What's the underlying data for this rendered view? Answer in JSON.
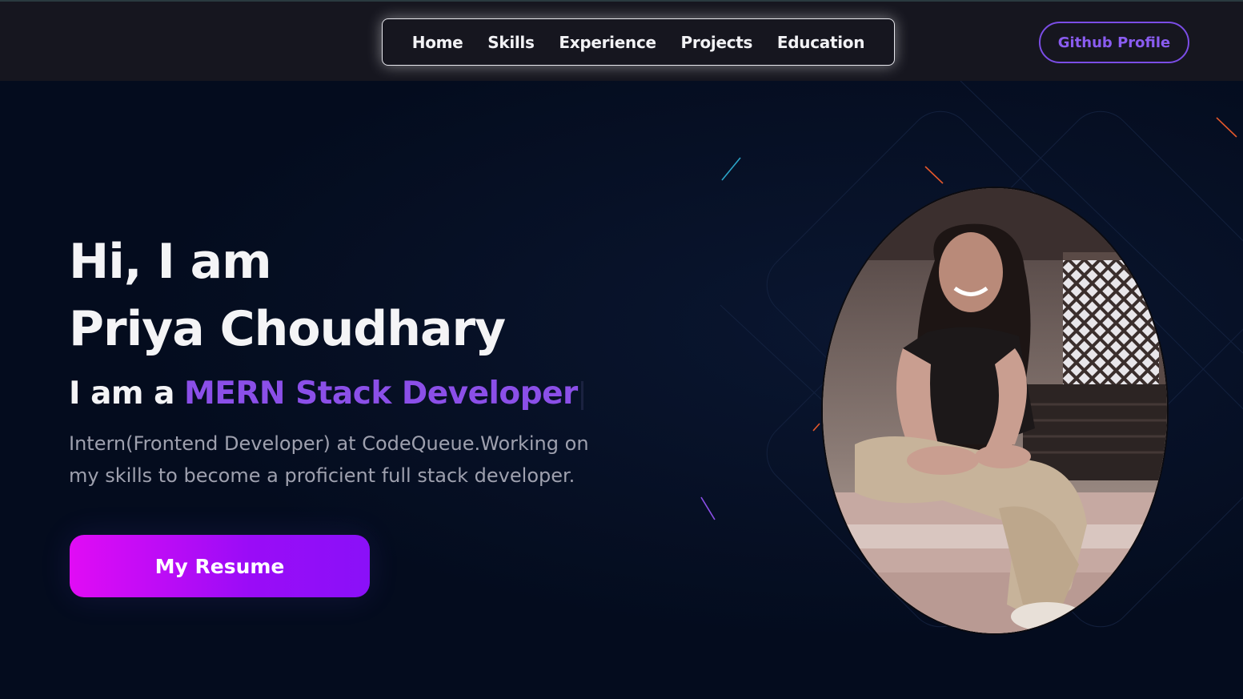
{
  "nav": {
    "items": [
      "Home",
      "Skills",
      "Experience",
      "Projects",
      "Education"
    ]
  },
  "header": {
    "github_label": "Github Profile"
  },
  "hero": {
    "greeting_line1": "Hi, I am",
    "name": "Priya Choudhary",
    "role_prefix": "I am a",
    "role_title": "MERN Stack Developer",
    "description": "Intern(Frontend Developer) at CodeQueue.Working on my skills to become a proficient full stack developer.",
    "resume_label": "My Resume"
  },
  "colors": {
    "background": "#040c1e",
    "header_bg": "#16161f",
    "accent_purple": "#8b4fe8",
    "button_gradient_start": "#e10cf5",
    "button_gradient_end": "#8a10f8"
  },
  "photo": {
    "icon": "profile-photo"
  }
}
